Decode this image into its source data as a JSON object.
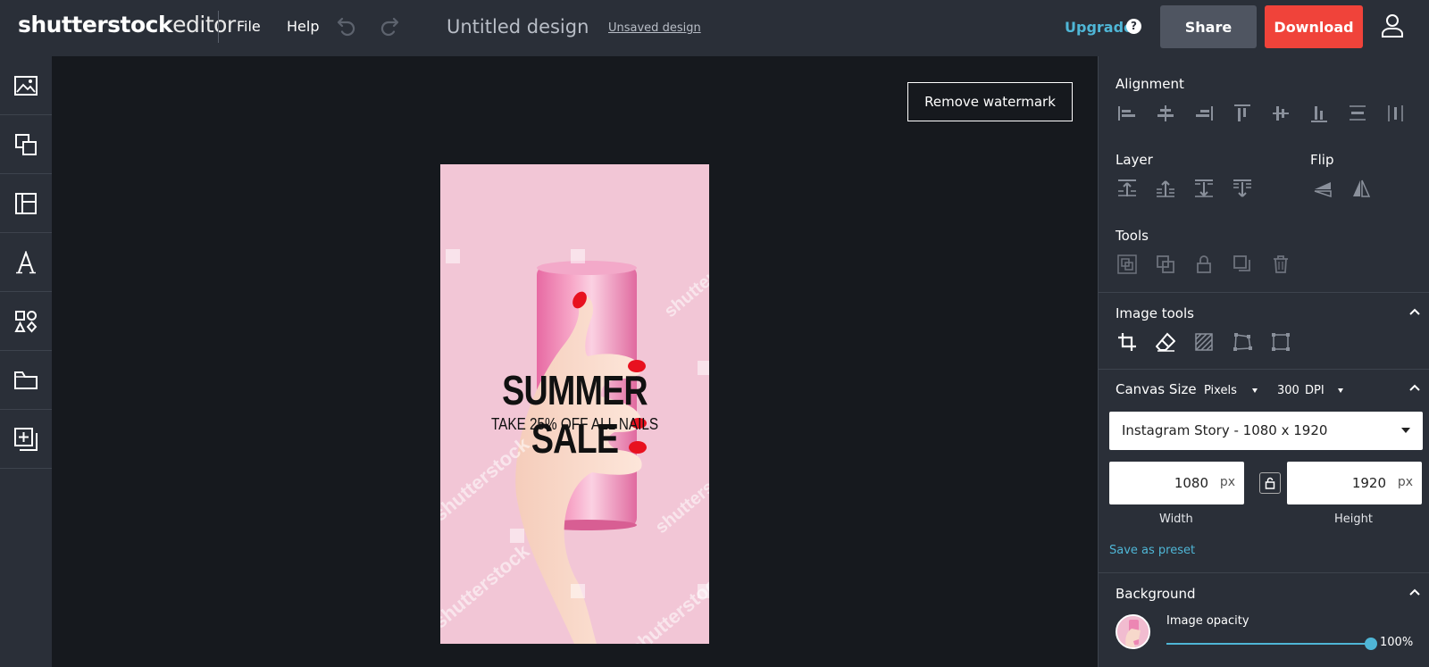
{
  "header": {
    "logo_brand": "shutterstock",
    "logo_product": "editor",
    "menu": {
      "file": "File",
      "help": "Help"
    },
    "design_title": "Untitled design",
    "save_status": "Unsaved design",
    "upgrade": "Upgrade",
    "help_icon": "?",
    "share": "Share",
    "download": "Download",
    "icons": {
      "undo": "undo-icon",
      "redo": "redo-icon",
      "account": "user-icon"
    }
  },
  "left_tools": [
    {
      "name": "images",
      "icon": "image-icon"
    },
    {
      "name": "layers",
      "icon": "layers-icon"
    },
    {
      "name": "templates",
      "icon": "template-icon"
    },
    {
      "name": "text",
      "icon": "text-icon"
    },
    {
      "name": "elements",
      "icon": "shapes-icon"
    },
    {
      "name": "uploads",
      "icon": "folder-icon"
    },
    {
      "name": "add-page",
      "icon": "add-page-icon"
    }
  ],
  "canvas": {
    "remove_watermark": "Remove watermark",
    "headline": "SUMMER SALE",
    "subhead": "TAKE 25% OFF ALL NAILS",
    "watermark_text": "shutterstock"
  },
  "panel": {
    "alignment_title": "Alignment",
    "layer_title": "Layer",
    "flip_title": "Flip",
    "tools_title": "Tools",
    "image_tools_title": "Image tools",
    "canvas_size_title": "Canvas Size",
    "unit_select": "Pixels",
    "dpi_value": "300",
    "dpi_label": "DPI",
    "preset_select": "Instagram Story - 1080 x 1920",
    "width_value": "1080",
    "height_value": "1920",
    "unit": "px",
    "width_label": "Width",
    "height_label": "Height",
    "save_preset": "Save as preset",
    "background_title": "Background",
    "image_opacity_label": "Image opacity",
    "image_opacity_value": "100%",
    "image_opacity_level": 1.0
  },
  "colors": {
    "accent": "#4fb6d6",
    "download": "#f0433a",
    "share": "#4f5561",
    "panel": "#2a2f38",
    "canvas_bg": "#16191e",
    "design_bg": "#f2c6d6"
  }
}
